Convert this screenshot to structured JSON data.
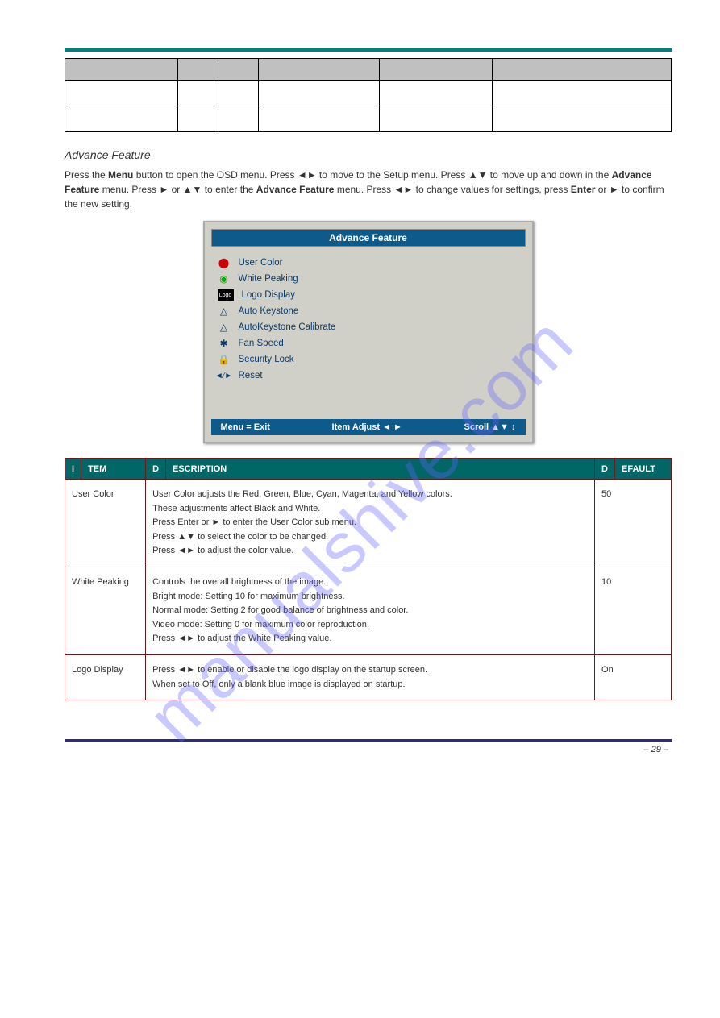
{
  "header": {
    "breadcrumb_left": "",
    "breadcrumb_right": ""
  },
  "topTable": {
    "headers": [
      "",
      "",
      "",
      "",
      "",
      ""
    ],
    "rows": [
      [
        "",
        "",
        "",
        "",
        "",
        ""
      ],
      [
        "",
        "",
        "",
        "",
        "",
        ""
      ]
    ]
  },
  "section": {
    "title": "Advance Feature",
    "instructions_p1_a": "Press the ",
    "instructions_p1_b": "Menu",
    "instructions_p1_c": " button to open the OSD menu. Press ",
    "instructions_arrows_lr": "◄►",
    "instructions_p1_d": " to move to the Setup menu. Press ",
    "instructions_arrows_ud": "▲▼",
    "instructions_p1_e": " to move up and down in the ",
    "instructions_p1_f": "Advance Feature",
    "instructions_p1_g": " menu. Press ",
    "instructions_arrows_r": "►",
    "instructions_p1_h": " or ",
    "instructions_p1_i": " to enter the ",
    "instructions_p1_j": "Advance Feature",
    "instructions_p1_k": " menu. Press ",
    "instructions_p1_l": " to change values for settings, press ",
    "instructions_p1_m": "Enter",
    "instructions_p1_n": " or ",
    "instructions_p1_o": " to confirm the new setting."
  },
  "osd": {
    "title": "Advance Feature",
    "items": [
      {
        "icon": "rgb-icon",
        "label": "User Color"
      },
      {
        "icon": "circle-icon",
        "label": "White Peaking"
      },
      {
        "icon": "logo-icon",
        "label": "Logo Display"
      },
      {
        "icon": "keystone-icon",
        "label": "Auto Keystone"
      },
      {
        "icon": "keystone-icon",
        "label": "AutoKeystone Calibrate"
      },
      {
        "icon": "fan-icon",
        "label": "Fan Speed"
      },
      {
        "icon": "lock-icon",
        "label": "Security Lock"
      },
      {
        "icon": "reset-icon",
        "label": "Reset"
      }
    ],
    "footer": {
      "left": "Menu = Exit",
      "middle": "Item Adjust   ◄ ►",
      "right": "Scroll   ▲▼ ↕"
    }
  },
  "descTable": {
    "headers": [
      "I",
      "",
      "D",
      "",
      "D"
    ],
    "header_labels": {
      "item": "TEM",
      "desc": "ESCRIPTION",
      "def": "EFAULT"
    },
    "rows": [
      {
        "item": "User Color",
        "desc_lines": [
          "User Color adjusts the Red, Green, Blue, Cyan, Magenta, and Yellow colors.",
          "These adjustments affect Black and White.",
          "Press Enter or ► to enter the User Color sub menu.",
          "Press ▲▼ to select the color to be changed.",
          "Press ◄► to adjust the color value."
        ],
        "default": "50"
      },
      {
        "item": "White Peaking",
        "desc_lines": [
          "Controls the overall brightness of the image.",
          "Bright mode: Setting 10 for maximum brightness.",
          "Normal mode: Setting 2 for good balance of brightness and color.",
          "Video mode: Setting 0 for maximum color reproduction.",
          "Press ◄► to adjust the White Peaking value."
        ],
        "default": "10"
      },
      {
        "item": "Logo Display",
        "desc_lines": [
          "Press ◄► to enable or disable the logo display on the startup screen.",
          "When set to Off, only a blank blue image is displayed on startup."
        ],
        "default": "On"
      }
    ]
  },
  "icons": {
    "rgb": "⬤",
    "circle": "◉",
    "logo": "Logo",
    "keystone": "△",
    "fan": "✱",
    "lock": "🔒",
    "reset": "◄⁄►"
  },
  "footer": {
    "pageNum": "– 29 –"
  },
  "watermark": "manualshive.com"
}
